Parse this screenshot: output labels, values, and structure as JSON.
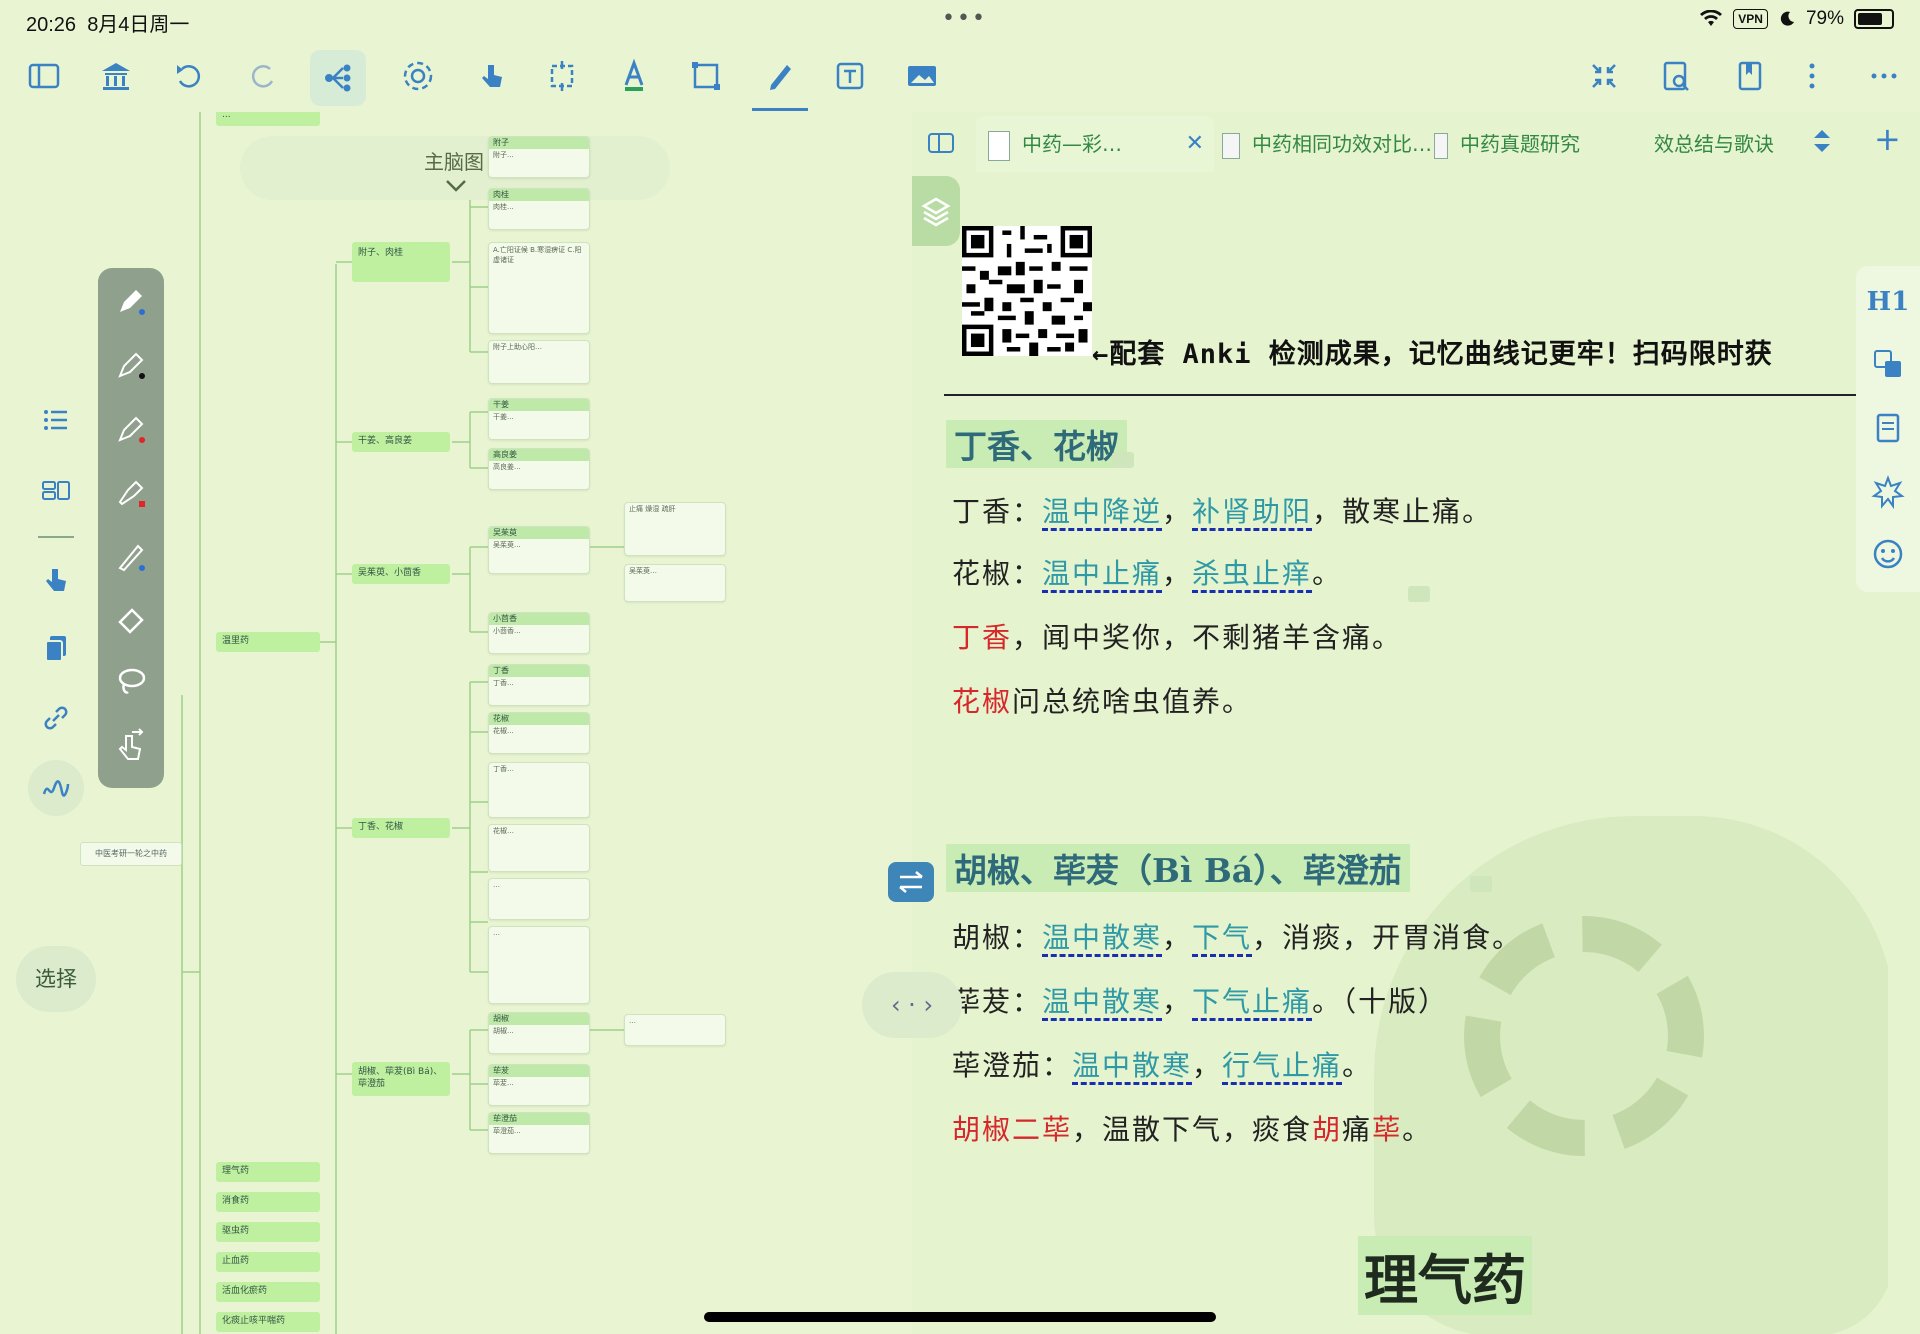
{
  "status": {
    "time": "20:26",
    "date": "8月4日周一",
    "vpn": "VPN",
    "battery": "79%"
  },
  "mindmap": {
    "title": "主脑图",
    "root": "中医考研一轮之中药",
    "top_clip": "...",
    "branches": [
      {
        "label": "附子、肉桂"
      },
      {
        "label": "干姜、高良姜"
      },
      {
        "label": "吴茱萸、小茴香"
      },
      {
        "label": "温里药"
      },
      {
        "label": "丁香、花椒"
      },
      {
        "label": "胡椒、荜茇(Bì Bá)、荜澄茄"
      }
    ],
    "leaves": [
      {
        "head": "附子",
        "body": "附子..."
      },
      {
        "head": "肉桂",
        "body": "肉桂..."
      },
      {
        "head": "干姜",
        "body": "干姜..."
      },
      {
        "head": "高良姜",
        "body": "高良姜..."
      },
      {
        "head": "吴茱萸",
        "body": "吴茱萸..."
      },
      {
        "head": "小茴香",
        "body": "小茴香..."
      },
      {
        "head": "丁香",
        "body": "丁香..."
      },
      {
        "head": "花椒",
        "body": "花椒..."
      },
      {
        "head": "胡椒",
        "body": "胡椒..."
      },
      {
        "head": "荜茇",
        "body": "荜茇..."
      },
      {
        "head": "荜澄茄",
        "body": "荜澄茄..."
      }
    ],
    "bottom_branches": [
      "理气药",
      "消食药",
      "驱虫药",
      "止血药",
      "活血化瘀药",
      "化痰止咳平喘药"
    ]
  },
  "left_panel": {
    "select_label": "选择"
  },
  "tabs": [
    {
      "label": "中药—彩…",
      "active": true,
      "close": "✕"
    },
    {
      "label": "中药相同功效对比…",
      "active": false
    },
    {
      "label": "中药真题研究",
      "active": false
    },
    {
      "label": "效总结与歌诀",
      "active": false
    }
  ],
  "tab_add": "+",
  "doc": {
    "anki_text": "←配套 Anki 检测成果，记忆曲线记更牢！扫码限时获",
    "heading1": "丁香、花椒",
    "dingxiang": {
      "name": "丁香：",
      "p1": "温中降逆",
      "sep1": "，",
      "p2": "补肾助阳",
      "sep2": "，散寒止痛。"
    },
    "huajiao": {
      "name": "花椒：",
      "p1": "温中止痛",
      "sep1": "，",
      "p2": "杀虫止痒",
      "end": "。"
    },
    "song1": {
      "red": "丁香",
      "rest": "，闻中奖你，不剩猪羊含痛。"
    },
    "song2": {
      "red": "花椒",
      "rest": "问总统啥虫值养。"
    },
    "heading2": "胡椒、荜茇（Bì Bá）、荜澄茄",
    "hujiao": {
      "name": "胡椒：",
      "p1": "温中散寒",
      "sep1": "，",
      "p2": "下气",
      "sep2": "，消痰，开胃消食。"
    },
    "bibo": {
      "name": "荜茇：",
      "p1": "温中散寒",
      "sep1": "，",
      "p2": "下气止痛",
      "end": "。（十版）"
    },
    "bichengqie": {
      "name": "荜澄茄：",
      "p1": "温中散寒",
      "sep1": "，",
      "p2": "行气止痛",
      "end": "。"
    },
    "song3": {
      "red": "胡椒二荜",
      "mid": "，温散下气，痰食",
      "red2": "胡",
      "mid2": "痛",
      "red3": "荜",
      "end": "。"
    },
    "heading3": "理气药"
  },
  "right_toolbar": {
    "h1": "H1"
  },
  "colors": {
    "bg": "#e9f5d2",
    "accent": "#3b82c4",
    "teal": "#2f9aa6",
    "red": "#d6272a",
    "underline": "#1a2fb0"
  }
}
